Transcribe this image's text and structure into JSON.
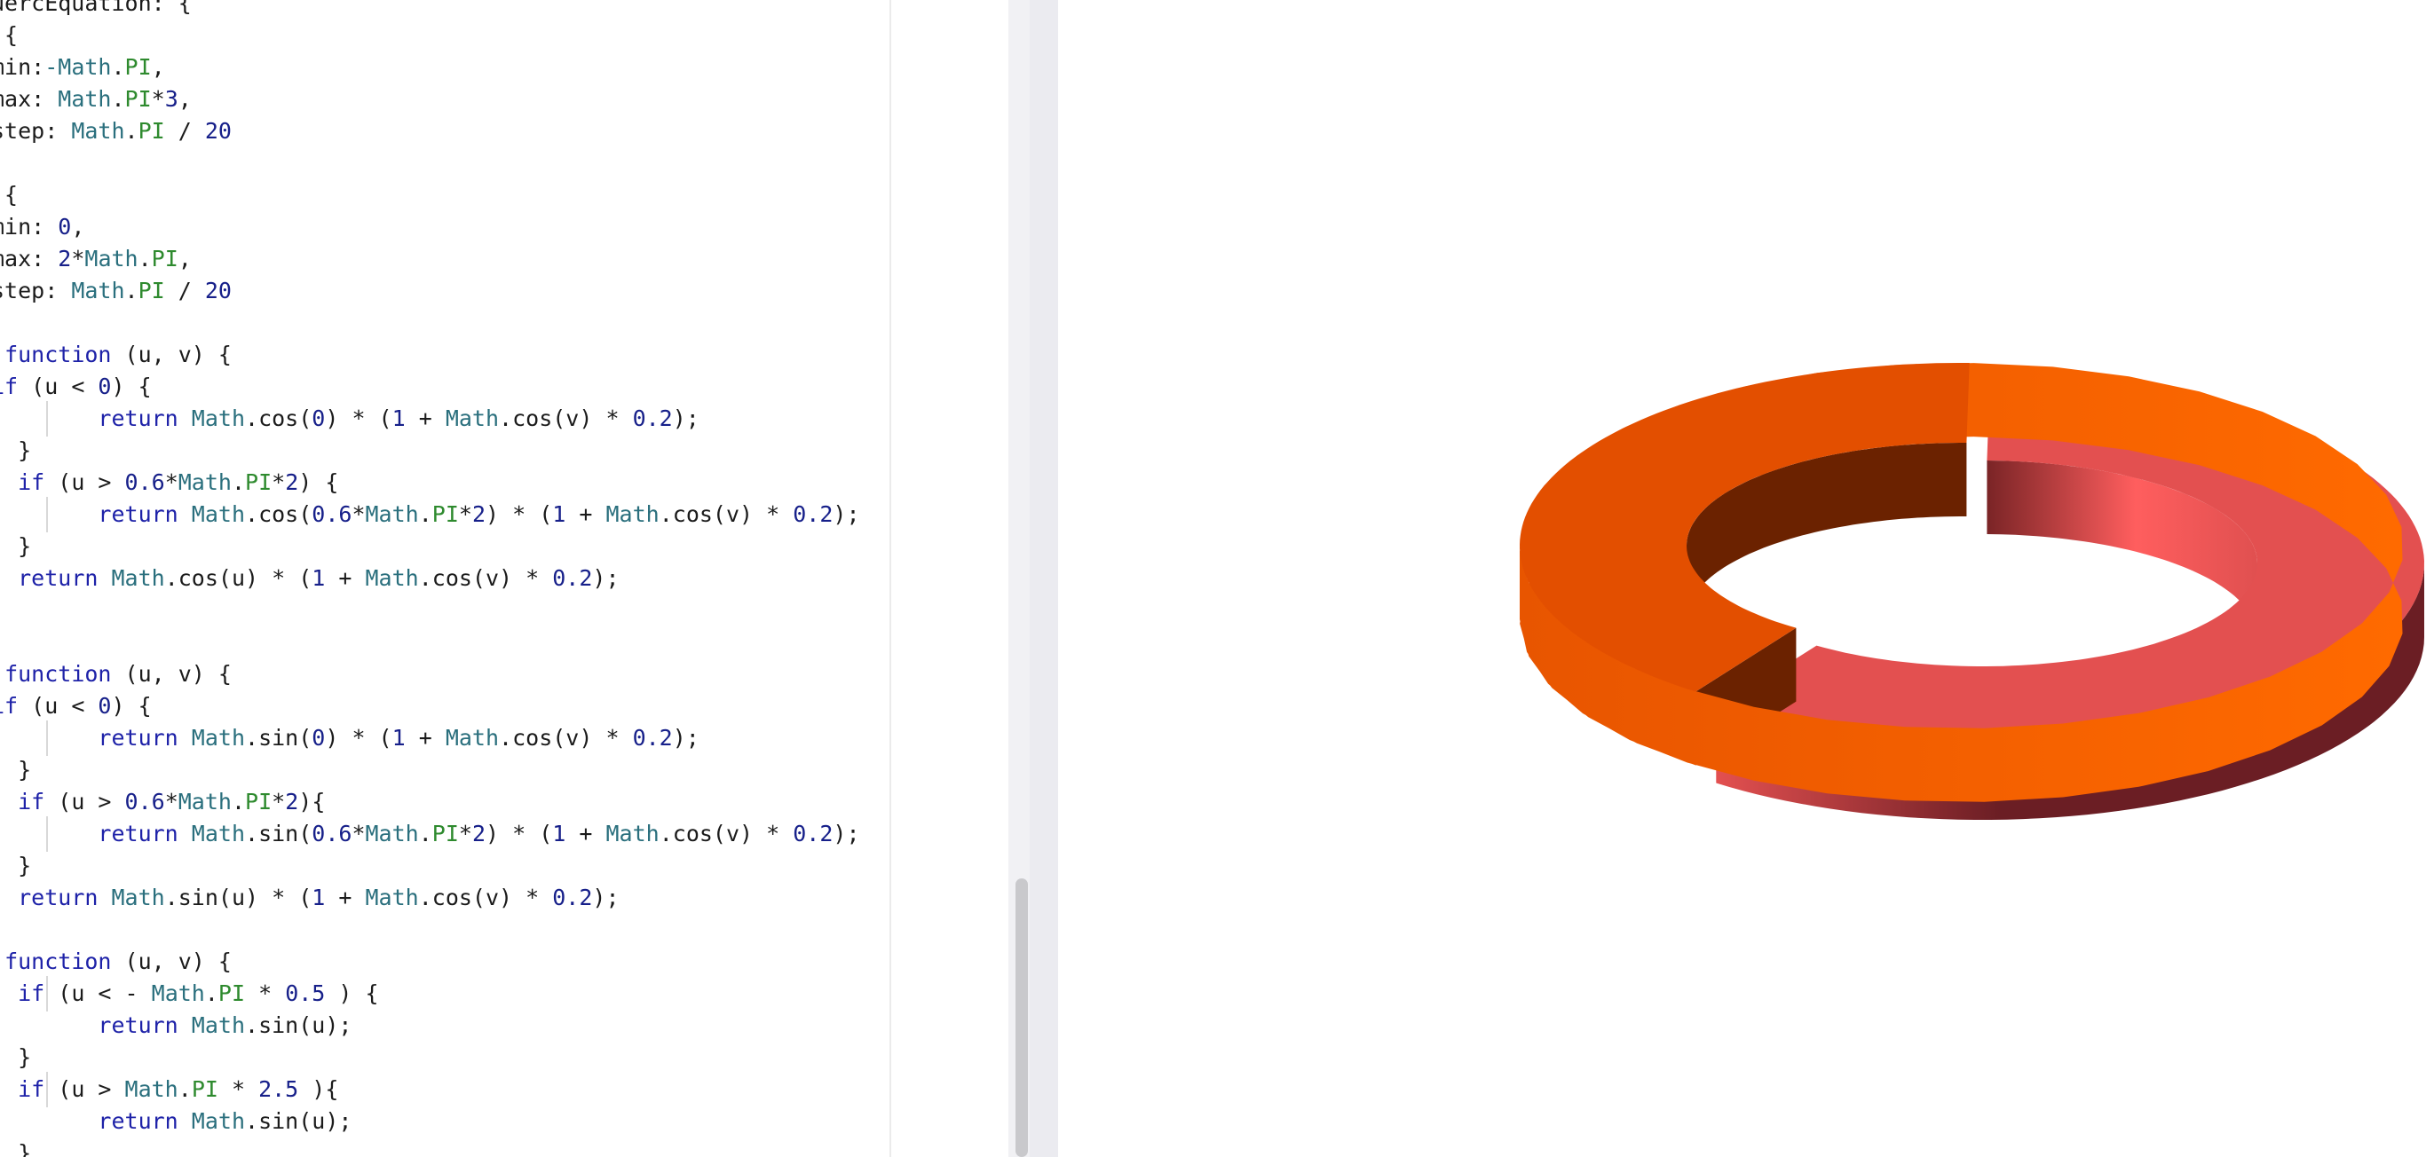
{
  "editor": {
    "lines": [
      [
        [
          "plain",
          "uercEquation: {"
        ]
      ],
      [
        [
          "plain",
          " {"
        ]
      ],
      [
        [
          "plain",
          "min:"
        ],
        [
          "obj",
          "-Math"
        ],
        [
          "plain",
          "."
        ],
        [
          "prop",
          "PI"
        ],
        [
          "plain",
          ","
        ]
      ],
      [
        [
          "plain",
          "max: "
        ],
        [
          "obj",
          "Math"
        ],
        [
          "plain",
          "."
        ],
        [
          "prop",
          "PI"
        ],
        [
          "plain",
          "*"
        ],
        [
          "num",
          "3"
        ],
        [
          "plain",
          ","
        ]
      ],
      [
        [
          "plain",
          "step: "
        ],
        [
          "obj",
          "Math"
        ],
        [
          "plain",
          "."
        ],
        [
          "prop",
          "PI"
        ],
        [
          "plain",
          " / "
        ],
        [
          "num",
          "20"
        ]
      ],
      [
        [
          "plain",
          ""
        ]
      ],
      [
        [
          "plain",
          " {"
        ]
      ],
      [
        [
          "plain",
          "min: "
        ],
        [
          "num",
          "0"
        ],
        [
          "plain",
          ","
        ]
      ],
      [
        [
          "plain",
          "max: "
        ],
        [
          "num",
          "2"
        ],
        [
          "plain",
          "*"
        ],
        [
          "obj",
          "Math"
        ],
        [
          "plain",
          "."
        ],
        [
          "prop",
          "PI"
        ],
        [
          "plain",
          ","
        ]
      ],
      [
        [
          "plain",
          "step: "
        ],
        [
          "obj",
          "Math"
        ],
        [
          "plain",
          "."
        ],
        [
          "prop",
          "PI"
        ],
        [
          "plain",
          " / "
        ],
        [
          "num",
          "20"
        ]
      ],
      [
        [
          "plain",
          ""
        ]
      ],
      [
        [
          "plain",
          " "
        ],
        [
          "kw",
          "function"
        ],
        [
          "plain",
          " (u, v) {"
        ]
      ],
      [
        [
          "kw",
          "if"
        ],
        [
          "plain",
          " (u < "
        ],
        [
          "num",
          "0"
        ],
        [
          "plain",
          ") {"
        ]
      ],
      [
        [
          "plain",
          "        "
        ],
        [
          "kw",
          "return"
        ],
        [
          "plain",
          " "
        ],
        [
          "obj",
          "Math"
        ],
        [
          "plain",
          ".cos("
        ],
        [
          "num",
          "0"
        ],
        [
          "plain",
          ") * ("
        ],
        [
          "num",
          "1"
        ],
        [
          "plain",
          " + "
        ],
        [
          "obj",
          "Math"
        ],
        [
          "plain",
          ".cos(v) * "
        ],
        [
          "num",
          "0.2"
        ],
        [
          "plain",
          ");"
        ]
      ],
      [
        [
          "plain",
          "  }"
        ]
      ],
      [
        [
          "plain",
          "  "
        ],
        [
          "kw",
          "if"
        ],
        [
          "plain",
          " (u > "
        ],
        [
          "num",
          "0.6"
        ],
        [
          "plain",
          "*"
        ],
        [
          "obj",
          "Math"
        ],
        [
          "plain",
          "."
        ],
        [
          "prop",
          "PI"
        ],
        [
          "plain",
          "*"
        ],
        [
          "num",
          "2"
        ],
        [
          "plain",
          ") {"
        ]
      ],
      [
        [
          "plain",
          "        "
        ],
        [
          "kw",
          "return"
        ],
        [
          "plain",
          " "
        ],
        [
          "obj",
          "Math"
        ],
        [
          "plain",
          ".cos("
        ],
        [
          "num",
          "0.6"
        ],
        [
          "plain",
          "*"
        ],
        [
          "obj",
          "Math"
        ],
        [
          "plain",
          "."
        ],
        [
          "prop",
          "PI"
        ],
        [
          "plain",
          "*"
        ],
        [
          "num",
          "2"
        ],
        [
          "plain",
          ") * ("
        ],
        [
          "num",
          "1"
        ],
        [
          "plain",
          " + "
        ],
        [
          "obj",
          "Math"
        ],
        [
          "plain",
          ".cos(v) * "
        ],
        [
          "num",
          "0.2"
        ],
        [
          "plain",
          ");"
        ]
      ],
      [
        [
          "plain",
          "  }"
        ]
      ],
      [
        [
          "plain",
          "  "
        ],
        [
          "kw",
          "return"
        ],
        [
          "plain",
          " "
        ],
        [
          "obj",
          "Math"
        ],
        [
          "plain",
          ".cos(u) * ("
        ],
        [
          "num",
          "1"
        ],
        [
          "plain",
          " + "
        ],
        [
          "obj",
          "Math"
        ],
        [
          "plain",
          ".cos(v) * "
        ],
        [
          "num",
          "0.2"
        ],
        [
          "plain",
          ");"
        ]
      ],
      [
        [
          "plain",
          ""
        ]
      ],
      [
        [
          "plain",
          ""
        ]
      ],
      [
        [
          "plain",
          " "
        ],
        [
          "kw",
          "function"
        ],
        [
          "plain",
          " (u, v) {"
        ]
      ],
      [
        [
          "kw",
          "if"
        ],
        [
          "plain",
          " (u < "
        ],
        [
          "num",
          "0"
        ],
        [
          "plain",
          ") {"
        ]
      ],
      [
        [
          "plain",
          "        "
        ],
        [
          "kw",
          "return"
        ],
        [
          "plain",
          " "
        ],
        [
          "obj",
          "Math"
        ],
        [
          "plain",
          ".sin("
        ],
        [
          "num",
          "0"
        ],
        [
          "plain",
          ") * ("
        ],
        [
          "num",
          "1"
        ],
        [
          "plain",
          " + "
        ],
        [
          "obj",
          "Math"
        ],
        [
          "plain",
          ".cos(v) * "
        ],
        [
          "num",
          "0.2"
        ],
        [
          "plain",
          ");"
        ]
      ],
      [
        [
          "plain",
          "  }"
        ]
      ],
      [
        [
          "plain",
          "  "
        ],
        [
          "kw",
          "if"
        ],
        [
          "plain",
          " (u > "
        ],
        [
          "num",
          "0.6"
        ],
        [
          "plain",
          "*"
        ],
        [
          "obj",
          "Math"
        ],
        [
          "plain",
          "."
        ],
        [
          "prop",
          "PI"
        ],
        [
          "plain",
          "*"
        ],
        [
          "num",
          "2"
        ],
        [
          "plain",
          "){"
        ]
      ],
      [
        [
          "plain",
          "        "
        ],
        [
          "kw",
          "return"
        ],
        [
          "plain",
          " "
        ],
        [
          "obj",
          "Math"
        ],
        [
          "plain",
          ".sin("
        ],
        [
          "num",
          "0.6"
        ],
        [
          "plain",
          "*"
        ],
        [
          "obj",
          "Math"
        ],
        [
          "plain",
          "."
        ],
        [
          "prop",
          "PI"
        ],
        [
          "plain",
          "*"
        ],
        [
          "num",
          "2"
        ],
        [
          "plain",
          ") * ("
        ],
        [
          "num",
          "1"
        ],
        [
          "plain",
          " + "
        ],
        [
          "obj",
          "Math"
        ],
        [
          "plain",
          ".cos(v) * "
        ],
        [
          "num",
          "0.2"
        ],
        [
          "plain",
          ");"
        ]
      ],
      [
        [
          "plain",
          "  }"
        ]
      ],
      [
        [
          "plain",
          "  "
        ],
        [
          "kw",
          "return"
        ],
        [
          "plain",
          " "
        ],
        [
          "obj",
          "Math"
        ],
        [
          "plain",
          ".sin(u) * ("
        ],
        [
          "num",
          "1"
        ],
        [
          "plain",
          " + "
        ],
        [
          "obj",
          "Math"
        ],
        [
          "plain",
          ".cos(v) * "
        ],
        [
          "num",
          "0.2"
        ],
        [
          "plain",
          ");"
        ]
      ],
      [
        [
          "plain",
          ""
        ]
      ],
      [
        [
          "plain",
          " "
        ],
        [
          "kw",
          "function"
        ],
        [
          "plain",
          " (u, v) {"
        ]
      ],
      [
        [
          "plain",
          "  "
        ],
        [
          "kw",
          "if"
        ],
        [
          "plain",
          " (u < - "
        ],
        [
          "obj",
          "Math"
        ],
        [
          "plain",
          "."
        ],
        [
          "prop",
          "PI"
        ],
        [
          "plain",
          " * "
        ],
        [
          "num",
          "0.5"
        ],
        [
          "plain",
          " ) {"
        ]
      ],
      [
        [
          "plain",
          "        "
        ],
        [
          "kw",
          "return"
        ],
        [
          "plain",
          " "
        ],
        [
          "obj",
          "Math"
        ],
        [
          "plain",
          ".sin(u);"
        ]
      ],
      [
        [
          "plain",
          "  }"
        ]
      ],
      [
        [
          "plain",
          "  "
        ],
        [
          "kw",
          "if"
        ],
        [
          "plain",
          " (u > "
        ],
        [
          "obj",
          "Math"
        ],
        [
          "plain",
          "."
        ],
        [
          "prop",
          "PI"
        ],
        [
          "plain",
          " * "
        ],
        [
          "num",
          "2.5"
        ],
        [
          "plain",
          " ){"
        ]
      ],
      [
        [
          "plain",
          "        "
        ],
        [
          "kw",
          "return"
        ],
        [
          "plain",
          " "
        ],
        [
          "obj",
          "Math"
        ],
        [
          "plain",
          ".sin(u);"
        ]
      ],
      [
        [
          "plain",
          "  }"
        ]
      ]
    ]
  },
  "chart_data": {
    "type": "pie",
    "title": "",
    "legend": "none",
    "values": [
      60,
      40
    ],
    "colors": [
      "#e35050",
      "#e34f00"
    ]
  }
}
